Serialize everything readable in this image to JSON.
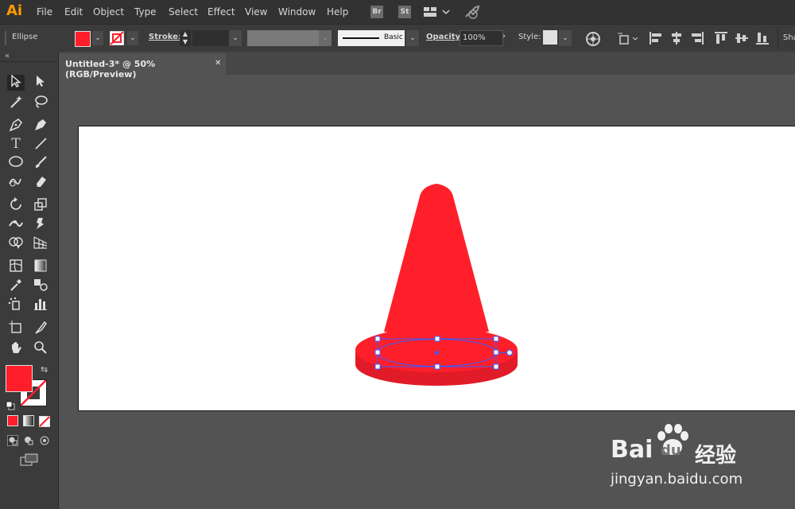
{
  "app": {
    "logo": "Ai"
  },
  "menu": [
    "File",
    "Edit",
    "Object",
    "Type",
    "Select",
    "Effect",
    "View",
    "Window",
    "Help"
  ],
  "app_icons": {
    "bridge": "Br",
    "stock": "St"
  },
  "control": {
    "object_type": "Ellipse",
    "fill_color": "#ff1e2a",
    "stroke_label": "Stroke:",
    "brush_label": "Basic",
    "opacity_label": "Opacity:",
    "opacity_value": "100%",
    "style_label": "Style:",
    "shape_label": "Sha"
  },
  "document": {
    "tab_title": "Untitled-3* @ 50% (RGB/Preview)",
    "close": "✕"
  },
  "canvas": {
    "cone_color": "#ff1f2b",
    "cone_shadow": "#e51a25",
    "selection_color": "#3d5bff"
  },
  "tools": [
    "selection-tool",
    "direct-selection-tool",
    "magic-wand-tool",
    "lasso-tool",
    "pen-tool",
    "curvature-tool",
    "type-tool",
    "line-tool",
    "ellipse-tool",
    "paintbrush-tool",
    "shaper-tool",
    "eraser-tool",
    "rotate-tool",
    "scale-tool",
    "width-tool",
    "puppet-warp-tool",
    "shape-builder-tool",
    "perspective-grid-tool",
    "mesh-tool",
    "gradient-tool",
    "eyedropper-tool",
    "blend-tool",
    "symbol-sprayer-tool",
    "column-graph-tool",
    "artboard-tool",
    "slice-tool",
    "hand-tool",
    "zoom-tool"
  ],
  "colors": {
    "fill": "#ff1e2a",
    "stroke": "none"
  },
  "watermark": {
    "brand_left": "Bai",
    "brand_right": "du",
    "label": "经验",
    "url": "jingyan.baidu.com"
  }
}
